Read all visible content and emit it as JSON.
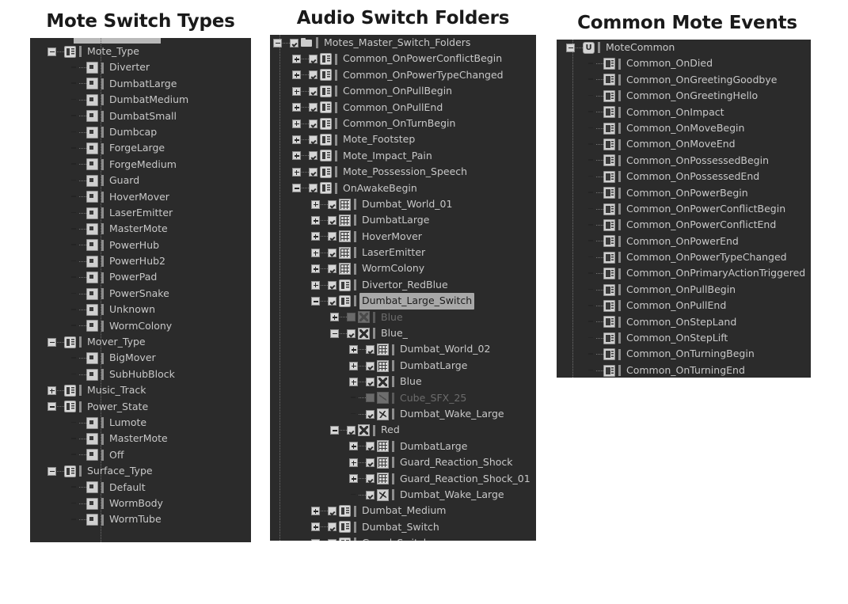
{
  "meta": {
    "bg": "#ffffff",
    "panel_bg": "#2b2b2b",
    "label_color": "#c8c8c8",
    "dim_color": "#6c6c6c",
    "selection_color": "#a8a8a8"
  },
  "panels": [
    {
      "id": "mote-switch-types",
      "title": "Mote Switch Types",
      "rows": [
        {
          "depth": 0,
          "exp": "minus",
          "check": "none",
          "icon": "switch-group-icon",
          "label": "Mote_Type"
        },
        {
          "depth": 1,
          "exp": "none",
          "check": "none",
          "icon": "inner-square-icon",
          "label": "Diverter"
        },
        {
          "depth": 1,
          "exp": "none",
          "check": "none",
          "icon": "inner-square-icon",
          "label": "DumbatLarge"
        },
        {
          "depth": 1,
          "exp": "none",
          "check": "none",
          "icon": "inner-square-icon",
          "label": "DumbatMedium"
        },
        {
          "depth": 1,
          "exp": "none",
          "check": "none",
          "icon": "inner-square-icon",
          "label": "DumbatSmall"
        },
        {
          "depth": 1,
          "exp": "none",
          "check": "none",
          "icon": "inner-square-icon",
          "label": "Dumbcap"
        },
        {
          "depth": 1,
          "exp": "none",
          "check": "none",
          "icon": "inner-square-icon",
          "label": "ForgeLarge"
        },
        {
          "depth": 1,
          "exp": "none",
          "check": "none",
          "icon": "inner-square-icon",
          "label": "ForgeMedium"
        },
        {
          "depth": 1,
          "exp": "none",
          "check": "none",
          "icon": "inner-square-icon",
          "label": "Guard"
        },
        {
          "depth": 1,
          "exp": "none",
          "check": "none",
          "icon": "inner-square-icon",
          "label": "HoverMover"
        },
        {
          "depth": 1,
          "exp": "none",
          "check": "none",
          "icon": "inner-square-icon",
          "label": "LaserEmitter"
        },
        {
          "depth": 1,
          "exp": "none",
          "check": "none",
          "icon": "inner-square-icon",
          "label": "MasterMote"
        },
        {
          "depth": 1,
          "exp": "none",
          "check": "none",
          "icon": "inner-square-icon",
          "label": "PowerHub"
        },
        {
          "depth": 1,
          "exp": "none",
          "check": "none",
          "icon": "inner-square-icon",
          "label": "PowerHub2"
        },
        {
          "depth": 1,
          "exp": "none",
          "check": "none",
          "icon": "inner-square-icon",
          "label": "PowerPad"
        },
        {
          "depth": 1,
          "exp": "none",
          "check": "none",
          "icon": "inner-square-icon",
          "label": "PowerSnake"
        },
        {
          "depth": 1,
          "exp": "none",
          "check": "none",
          "icon": "inner-square-icon",
          "label": "Unknown"
        },
        {
          "depth": 1,
          "exp": "none",
          "check": "none",
          "icon": "inner-square-icon",
          "label": "WormColony"
        },
        {
          "depth": 0,
          "exp": "minus",
          "check": "none",
          "icon": "switch-group-icon",
          "label": "Mover_Type"
        },
        {
          "depth": 1,
          "exp": "none",
          "check": "none",
          "icon": "inner-square-icon",
          "label": "BigMover"
        },
        {
          "depth": 1,
          "exp": "none",
          "check": "none",
          "icon": "inner-square-icon",
          "label": "SubHubBlock"
        },
        {
          "depth": 0,
          "exp": "plus",
          "check": "none",
          "icon": "switch-group-icon",
          "label": "Music_Track"
        },
        {
          "depth": 0,
          "exp": "minus",
          "check": "none",
          "icon": "switch-group-icon",
          "label": "Power_State"
        },
        {
          "depth": 1,
          "exp": "none",
          "check": "none",
          "icon": "inner-square-icon",
          "label": "Lumote"
        },
        {
          "depth": 1,
          "exp": "none",
          "check": "none",
          "icon": "inner-square-icon",
          "label": "MasterMote"
        },
        {
          "depth": 1,
          "exp": "none",
          "check": "none",
          "icon": "inner-square-icon",
          "label": "Off"
        },
        {
          "depth": 0,
          "exp": "minus",
          "check": "none",
          "icon": "switch-group-icon",
          "label": "Surface_Type"
        },
        {
          "depth": 1,
          "exp": "none",
          "check": "none",
          "icon": "inner-square-icon",
          "label": "Default"
        },
        {
          "depth": 1,
          "exp": "none",
          "check": "none",
          "icon": "inner-square-icon",
          "label": "WormBody"
        },
        {
          "depth": 1,
          "exp": "none",
          "check": "none",
          "icon": "inner-square-icon",
          "label": "WormTube"
        }
      ]
    },
    {
      "id": "audio-switch-folders",
      "title": "Audio Switch Folders",
      "rows": [
        {
          "depth": 0,
          "exp": "minus",
          "check": "on",
          "icon": "folder-icon",
          "label": "Motes_Master_Switch_Folders"
        },
        {
          "depth": 1,
          "exp": "plus",
          "check": "on",
          "icon": "switch-group-icon",
          "label": "Common_OnPowerConflictBegin"
        },
        {
          "depth": 1,
          "exp": "plus",
          "check": "on",
          "icon": "switch-group-icon",
          "label": "Common_OnPowerTypeChanged"
        },
        {
          "depth": 1,
          "exp": "plus",
          "check": "on",
          "icon": "switch-group-icon",
          "label": "Common_OnPullBegin"
        },
        {
          "depth": 1,
          "exp": "plus",
          "check": "on",
          "icon": "switch-group-icon",
          "label": "Common_OnPullEnd"
        },
        {
          "depth": 1,
          "exp": "plus",
          "check": "on",
          "icon": "switch-group-icon",
          "label": "Common_OnTurnBegin"
        },
        {
          "depth": 1,
          "exp": "plus",
          "check": "on",
          "icon": "switch-group-icon",
          "label": "Mote_Footstep"
        },
        {
          "depth": 1,
          "exp": "plus",
          "check": "on",
          "icon": "switch-group-icon",
          "label": "Mote_Impact_Pain"
        },
        {
          "depth": 1,
          "exp": "plus",
          "check": "on",
          "icon": "switch-group-icon",
          "label": "Mote_Possession_Speech"
        },
        {
          "depth": 1,
          "exp": "minus",
          "check": "on",
          "icon": "switch-group-icon",
          "label": "OnAwakeBegin"
        },
        {
          "depth": 2,
          "exp": "plus",
          "check": "on",
          "icon": "grid-icon",
          "label": "Dumbat_World_01"
        },
        {
          "depth": 2,
          "exp": "plus",
          "check": "on",
          "icon": "grid-icon",
          "label": "DumbatLarge"
        },
        {
          "depth": 2,
          "exp": "plus",
          "check": "on",
          "icon": "grid-icon",
          "label": "HoverMover"
        },
        {
          "depth": 2,
          "exp": "plus",
          "check": "on",
          "icon": "grid-icon",
          "label": "LaserEmitter"
        },
        {
          "depth": 2,
          "exp": "plus",
          "check": "on",
          "icon": "grid-icon",
          "label": "WormColony"
        },
        {
          "depth": 2,
          "exp": "plus",
          "check": "on",
          "icon": "switch-group-icon",
          "label": "Divertor_RedBlue"
        },
        {
          "depth": 2,
          "exp": "minus",
          "check": "on",
          "icon": "switch-group-icon",
          "label": "Dumbat_Large_Switch",
          "selected": true
        },
        {
          "depth": 3,
          "exp": "plus",
          "check": "off",
          "icon": "switch-x-icon",
          "label": "Blue",
          "dim": true
        },
        {
          "depth": 3,
          "exp": "minus",
          "check": "on",
          "icon": "switch-x-icon",
          "label": "Blue_"
        },
        {
          "depth": 4,
          "exp": "plus",
          "check": "on",
          "icon": "grid-icon",
          "label": "Dumbat_World_02"
        },
        {
          "depth": 4,
          "exp": "plus",
          "check": "on",
          "icon": "grid-icon",
          "label": "DumbatLarge"
        },
        {
          "depth": 4,
          "exp": "plus",
          "check": "on",
          "icon": "switch-x-icon",
          "label": "Blue"
        },
        {
          "depth": 4,
          "exp": "none",
          "check": "off",
          "icon": "sfx-icon",
          "label": "Cube_SFX_25",
          "dim": true
        },
        {
          "depth": 4,
          "exp": "none",
          "check": "on",
          "icon": "sfx-icon",
          "label": "Dumbat_Wake_Large"
        },
        {
          "depth": 3,
          "exp": "minus",
          "check": "on",
          "icon": "switch-x-icon",
          "label": "Red"
        },
        {
          "depth": 4,
          "exp": "plus",
          "check": "on",
          "icon": "grid-icon",
          "label": "DumbatLarge"
        },
        {
          "depth": 4,
          "exp": "plus",
          "check": "on",
          "icon": "grid-icon",
          "label": "Guard_Reaction_Shock"
        },
        {
          "depth": 4,
          "exp": "plus",
          "check": "on",
          "icon": "grid-icon",
          "label": "Guard_Reaction_Shock_01"
        },
        {
          "depth": 4,
          "exp": "none",
          "check": "on",
          "icon": "sfx-icon",
          "label": "Dumbat_Wake_Large"
        },
        {
          "depth": 2,
          "exp": "plus",
          "check": "on",
          "icon": "switch-group-icon",
          "label": "Dumbat_Medium"
        },
        {
          "depth": 2,
          "exp": "plus",
          "check": "on",
          "icon": "switch-group-icon",
          "label": "Dumbat_Switch"
        },
        {
          "depth": 2,
          "exp": "plus",
          "check": "on",
          "icon": "switch-group-icon",
          "label": "Guard_Switch"
        }
      ]
    },
    {
      "id": "common-mote-events",
      "title": "Common Mote Events",
      "rows": [
        {
          "depth": 0,
          "exp": "minus",
          "check": "none",
          "icon": "unreal-icon",
          "label": "MoteCommon"
        },
        {
          "depth": 1,
          "exp": "none",
          "check": "none",
          "icon": "event-icon",
          "label": "Common_OnDied"
        },
        {
          "depth": 1,
          "exp": "none",
          "check": "none",
          "icon": "event-icon",
          "label": "Common_OnGreetingGoodbye"
        },
        {
          "depth": 1,
          "exp": "none",
          "check": "none",
          "icon": "event-icon",
          "label": "Common_OnGreetingHello"
        },
        {
          "depth": 1,
          "exp": "none",
          "check": "none",
          "icon": "event-icon",
          "label": "Common_OnImpact"
        },
        {
          "depth": 1,
          "exp": "none",
          "check": "none",
          "icon": "event-icon",
          "label": "Common_OnMoveBegin"
        },
        {
          "depth": 1,
          "exp": "none",
          "check": "none",
          "icon": "event-icon",
          "label": "Common_OnMoveEnd"
        },
        {
          "depth": 1,
          "exp": "none",
          "check": "none",
          "icon": "event-icon",
          "label": "Common_OnPossessedBegin"
        },
        {
          "depth": 1,
          "exp": "none",
          "check": "none",
          "icon": "event-icon",
          "label": "Common_OnPossessedEnd"
        },
        {
          "depth": 1,
          "exp": "none",
          "check": "none",
          "icon": "event-icon",
          "label": "Common_OnPowerBegin"
        },
        {
          "depth": 1,
          "exp": "none",
          "check": "none",
          "icon": "event-icon",
          "label": "Common_OnPowerConflictBegin"
        },
        {
          "depth": 1,
          "exp": "none",
          "check": "none",
          "icon": "event-icon",
          "label": "Common_OnPowerConflictEnd"
        },
        {
          "depth": 1,
          "exp": "none",
          "check": "none",
          "icon": "event-icon",
          "label": "Common_OnPowerEnd"
        },
        {
          "depth": 1,
          "exp": "none",
          "check": "none",
          "icon": "event-icon",
          "label": "Common_OnPowerTypeChanged"
        },
        {
          "depth": 1,
          "exp": "none",
          "check": "none",
          "icon": "event-icon",
          "label": "Common_OnPrimaryActionTriggered"
        },
        {
          "depth": 1,
          "exp": "none",
          "check": "none",
          "icon": "event-icon",
          "label": "Common_OnPullBegin"
        },
        {
          "depth": 1,
          "exp": "none",
          "check": "none",
          "icon": "event-icon",
          "label": "Common_OnPullEnd"
        },
        {
          "depth": 1,
          "exp": "none",
          "check": "none",
          "icon": "event-icon",
          "label": "Common_OnStepLand"
        },
        {
          "depth": 1,
          "exp": "none",
          "check": "none",
          "icon": "event-icon",
          "label": "Common_OnStepLift"
        },
        {
          "depth": 1,
          "exp": "none",
          "check": "none",
          "icon": "event-icon",
          "label": "Common_OnTurningBegin"
        },
        {
          "depth": 1,
          "exp": "none",
          "check": "none",
          "icon": "event-icon",
          "label": "Common_OnTurningEnd"
        }
      ]
    }
  ]
}
